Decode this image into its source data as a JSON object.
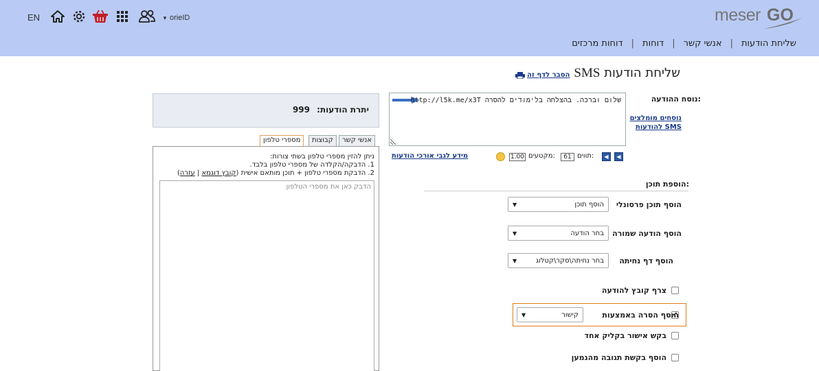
{
  "header": {
    "lang": "EN",
    "icons": [
      "home-icon",
      "gear-icon",
      "basket-icon",
      "apps-grid-icon",
      "users-icon"
    ],
    "username": "orieID",
    "logo": {
      "part1": "meser",
      "part2": "GO"
    },
    "nav": [
      {
        "label": "שליחת הודעות"
      },
      {
        "label": "אנשי קשר"
      },
      {
        "label": "דוחות"
      },
      {
        "label": "דוחות מרכזים"
      }
    ],
    "nav_sep": "|"
  },
  "page": {
    "title": "שליחת הודעות",
    "title_sms": "SMS",
    "explain_link": "הסבר לדף זה"
  },
  "message": {
    "label": "נוסח ההודעה:",
    "text": "שלום וברכה. בהצלחה בלימודים להסרה http://l5k.me/x3T",
    "recommended_link": "נוסחים מומלצים להודעות SMS",
    "chars_label": "תווים:",
    "chars_value": "61",
    "segments_label": "מקטעים:",
    "segments_value": "1.00",
    "long_msg_link": "מידע לגבי אורכי הודעות"
  },
  "add_content": {
    "title": "הוספת תוכן:",
    "rows": [
      {
        "label": "הוסף תוכן פרסונלי",
        "select": "הוסף תוכן"
      },
      {
        "label": "הוסף הודעה שמורה",
        "select": "בחר הודעה"
      },
      {
        "label": "הוסף דף נחיתה",
        "select": "בחר נחיתה\\סקר\\קטלוג"
      }
    ],
    "checkboxes": [
      {
        "label": "צרף קובץ להודעה",
        "checked": false
      },
      {
        "label": "הוסף הסרה באמצעות",
        "checked": true,
        "select": "קישור"
      },
      {
        "label": "בקש אישור בקליק אחד",
        "checked": false
      },
      {
        "label": "הוסף בקשת תגובה מהנמען",
        "checked": false
      }
    ]
  },
  "recipients": {
    "balance_label": "יתרת הודעות:",
    "balance_value": "999",
    "tabs": [
      "מספרי טלפון",
      "קבוצות",
      "אנשי קשר"
    ],
    "active_tab": "מספרי טלפון",
    "instructions": {
      "line1": "ניתן להזין מספרי טלפון בשתי צורות:",
      "line2": "1. הדבקה/הקלדה של מספרי טלפון בלבד.",
      "line3": "2. הדבקת מספרי טלפון + תוכן מותאם אישית",
      "sample_link": "קובץ דוגמא",
      "help_link": "עזרה"
    },
    "phone_placeholder": "הדבק כאן את מספרי הטלפון"
  },
  "colors": {
    "header_bg": "#b9cbf5",
    "link": "#1a3a8a",
    "highlight_border": "#e07d1a",
    "arrow": "#3a6fc4"
  }
}
